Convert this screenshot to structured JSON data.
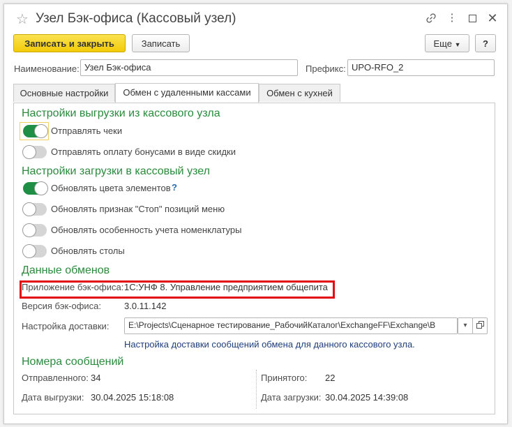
{
  "window": {
    "title": "Узел Бэк-офиса (Кассовый узел)"
  },
  "toolbar": {
    "save_close": "Записать и закрыть",
    "save": "Записать",
    "more": "Еще",
    "help": "?"
  },
  "fields": {
    "name_label": "Наименование:",
    "name_value": "Узел Бэк-офиса",
    "prefix_label": "Префикс:",
    "prefix_value": "UPO-RFO_2"
  },
  "tabs": [
    {
      "label": "Основные настройки",
      "active": false
    },
    {
      "label": "Обмен с удаленными кассами",
      "active": true
    },
    {
      "label": "Обмен с кухней",
      "active": false
    }
  ],
  "export_section": {
    "title": "Настройки выгрузки из кассового узла",
    "options": [
      {
        "label": "Отправлять чеки",
        "on": true
      },
      {
        "label": "Отправлять оплату бонусами в виде скидки",
        "on": false
      }
    ]
  },
  "import_section": {
    "title": "Настройки загрузки в кассовый узел",
    "options": [
      {
        "label": "Обновлять цвета элементов",
        "on": true,
        "help": "?"
      },
      {
        "label": "Обновлять признак \"Стоп\" позиций меню",
        "on": false
      },
      {
        "label": "Обновлять особенность учета номенклатуры",
        "on": false
      },
      {
        "label": "Обновлять столы",
        "on": false
      }
    ]
  },
  "exchange_section": {
    "title": "Данные обменов",
    "app_label": "Приложение бэк-офиса:",
    "app_value": "1С:УНФ 8. Управление предприятием общепита",
    "version_label": "Версия бэк-офиса:",
    "version_value": "3.0.11.142",
    "delivery_label": "Настройка доставки:",
    "delivery_value": "E:\\Projects\\Сценарное тестирование_РабочийКаталог\\ExchangeFF\\Exchange\\В",
    "delivery_link": "Настройка доставки сообщений обмена для данного кассового узла."
  },
  "messages_section": {
    "title": "Номера сообщений",
    "sent_label": "Отправленного:",
    "sent_value": "34",
    "received_label": "Принятого:",
    "received_value": "22",
    "upload_date_label": "Дата выгрузки:",
    "upload_date_value": "30.04.2025 15:18:08",
    "download_date_label": "Дата загрузки:",
    "download_date_value": "30.04.2025 14:39:08"
  },
  "colors": {
    "accent_green": "#2b8a3e",
    "primary_button": "#f2cb08",
    "highlight_border": "#e30613"
  }
}
